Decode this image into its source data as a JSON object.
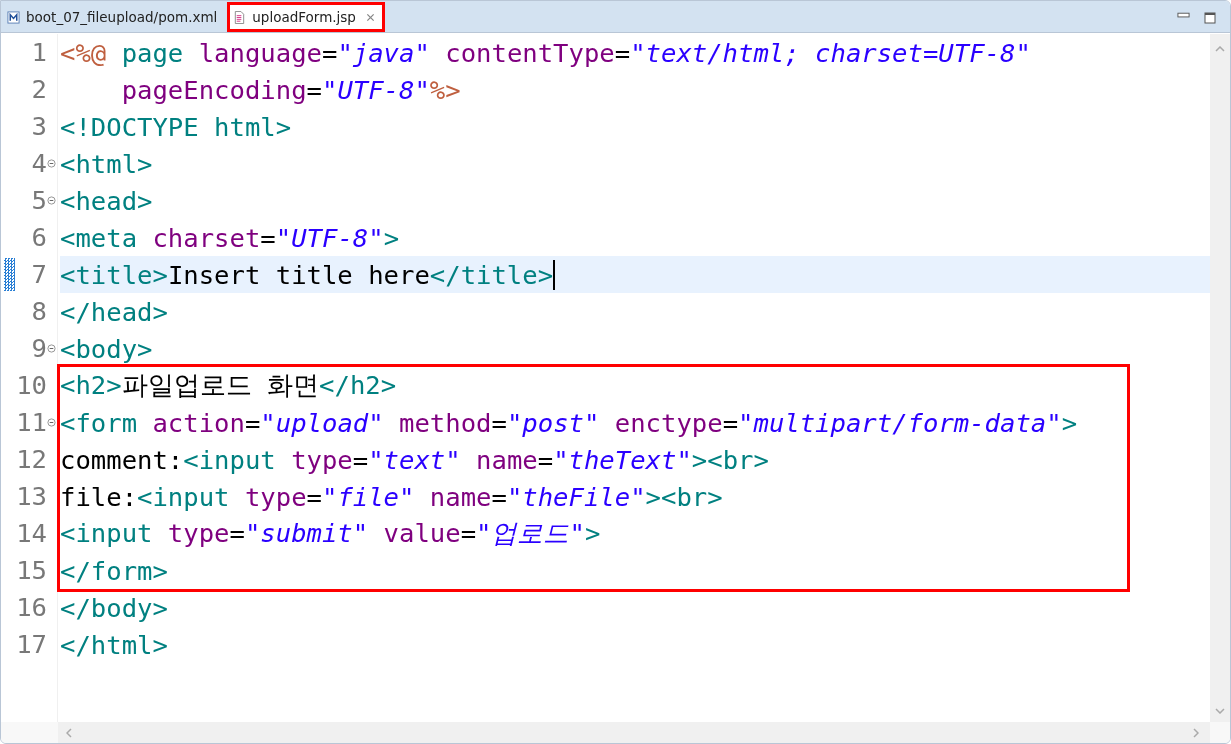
{
  "tabs": [
    {
      "label": "boot_07_fileupload/pom.xml",
      "kind": "xml",
      "selected": false,
      "marked": false
    },
    {
      "label": "uploadForm.jsp",
      "kind": "jsp",
      "selected": true,
      "marked": true
    }
  ],
  "lines": [
    {
      "number": "1",
      "foldable": false,
      "current": false,
      "marked": false,
      "tokens": [
        {
          "kind": "jsp",
          "text": "<%@"
        },
        {
          "kind": "tag",
          "text": " page"
        },
        {
          "kind": "attr",
          "text": " language"
        },
        {
          "kind": "text",
          "text": "="
        },
        {
          "kind": "string",
          "text": "\"java\""
        },
        {
          "kind": "attr",
          "text": " contentType"
        },
        {
          "kind": "text",
          "text": "="
        },
        {
          "kind": "string",
          "text": "\"text/html; charset=UTF-8\""
        }
      ]
    },
    {
      "number": "2",
      "foldable": false,
      "current": false,
      "marked": false,
      "tokens": [
        {
          "kind": "attr",
          "text": "    pageEncoding"
        },
        {
          "kind": "text",
          "text": "="
        },
        {
          "kind": "string",
          "text": "\"UTF-8\""
        },
        {
          "kind": "jsp",
          "text": "%>"
        }
      ]
    },
    {
      "number": "3",
      "foldable": false,
      "current": false,
      "marked": false,
      "tokens": [
        {
          "kind": "tag",
          "text": "<!DOCTYPE html>"
        }
      ]
    },
    {
      "number": "4",
      "foldable": true,
      "current": false,
      "marked": false,
      "tokens": [
        {
          "kind": "tag",
          "text": "<html>"
        }
      ]
    },
    {
      "number": "5",
      "foldable": true,
      "current": false,
      "marked": false,
      "tokens": [
        {
          "kind": "tag",
          "text": "<head>"
        }
      ]
    },
    {
      "number": "6",
      "foldable": false,
      "current": false,
      "marked": false,
      "tokens": [
        {
          "kind": "tag",
          "text": "<meta"
        },
        {
          "kind": "attr",
          "text": " charset"
        },
        {
          "kind": "text",
          "text": "="
        },
        {
          "kind": "string",
          "text": "\"UTF-8\""
        },
        {
          "kind": "tag",
          "text": ">"
        }
      ]
    },
    {
      "number": "7",
      "foldable": false,
      "current": true,
      "marked": false,
      "tokens": [
        {
          "kind": "tag",
          "text": "<title>"
        },
        {
          "kind": "text",
          "text": "Insert title here"
        },
        {
          "kind": "tag",
          "text": "</title>"
        }
      ]
    },
    {
      "number": "8",
      "foldable": false,
      "current": false,
      "marked": false,
      "tokens": [
        {
          "kind": "tag",
          "text": "</head>"
        }
      ]
    },
    {
      "number": "9",
      "foldable": true,
      "current": false,
      "marked": false,
      "tokens": [
        {
          "kind": "tag",
          "text": "<body>"
        }
      ]
    },
    {
      "number": "10",
      "foldable": false,
      "current": false,
      "marked": true,
      "tokens": [
        {
          "kind": "tag",
          "text": "<h2>"
        },
        {
          "kind": "text",
          "text": "파일업로드 화면"
        },
        {
          "kind": "tag",
          "text": "</h2>"
        }
      ]
    },
    {
      "number": "11",
      "foldable": true,
      "current": false,
      "marked": true,
      "tokens": [
        {
          "kind": "tag",
          "text": "<form"
        },
        {
          "kind": "attr",
          "text": " action"
        },
        {
          "kind": "text",
          "text": "="
        },
        {
          "kind": "string",
          "text": "\"upload\""
        },
        {
          "kind": "attr",
          "text": " method"
        },
        {
          "kind": "text",
          "text": "="
        },
        {
          "kind": "string",
          "text": "\"post\""
        },
        {
          "kind": "attr",
          "text": " enctype"
        },
        {
          "kind": "text",
          "text": "="
        },
        {
          "kind": "string",
          "text": "\"multipart/form-data\""
        },
        {
          "kind": "tag",
          "text": ">"
        }
      ]
    },
    {
      "number": "12",
      "foldable": false,
      "current": false,
      "marked": true,
      "tokens": [
        {
          "kind": "text",
          "text": "comment:"
        },
        {
          "kind": "tag",
          "text": "<input"
        },
        {
          "kind": "attr",
          "text": " type"
        },
        {
          "kind": "text",
          "text": "="
        },
        {
          "kind": "string",
          "text": "\"text\""
        },
        {
          "kind": "attr",
          "text": " name"
        },
        {
          "kind": "text",
          "text": "="
        },
        {
          "kind": "string",
          "text": "\"theText\""
        },
        {
          "kind": "tag",
          "text": "><br>"
        }
      ]
    },
    {
      "number": "13",
      "foldable": false,
      "current": false,
      "marked": true,
      "tokens": [
        {
          "kind": "text",
          "text": "file:"
        },
        {
          "kind": "tag",
          "text": "<input"
        },
        {
          "kind": "attr",
          "text": " type"
        },
        {
          "kind": "text",
          "text": "="
        },
        {
          "kind": "string",
          "text": "\"file\""
        },
        {
          "kind": "attr",
          "text": " name"
        },
        {
          "kind": "text",
          "text": "="
        },
        {
          "kind": "string",
          "text": "\"theFile\""
        },
        {
          "kind": "tag",
          "text": "><br>"
        }
      ]
    },
    {
      "number": "14",
      "foldable": false,
      "current": false,
      "marked": true,
      "tokens": [
        {
          "kind": "tag",
          "text": "<input"
        },
        {
          "kind": "attr",
          "text": " type"
        },
        {
          "kind": "text",
          "text": "="
        },
        {
          "kind": "string",
          "text": "\"submit\""
        },
        {
          "kind": "attr",
          "text": " value"
        },
        {
          "kind": "text",
          "text": "="
        },
        {
          "kind": "string",
          "text": "\"업로드\""
        },
        {
          "kind": "tag",
          "text": ">"
        }
      ]
    },
    {
      "number": "15",
      "foldable": false,
      "current": false,
      "marked": true,
      "tokens": [
        {
          "kind": "tag",
          "text": "</form>"
        }
      ]
    },
    {
      "number": "16",
      "foldable": false,
      "current": false,
      "marked": false,
      "tokens": [
        {
          "kind": "tag",
          "text": "</body>"
        }
      ]
    },
    {
      "number": "17",
      "foldable": false,
      "current": false,
      "marked": false,
      "tokens": [
        {
          "kind": "tag",
          "text": "</html>"
        }
      ]
    }
  ]
}
